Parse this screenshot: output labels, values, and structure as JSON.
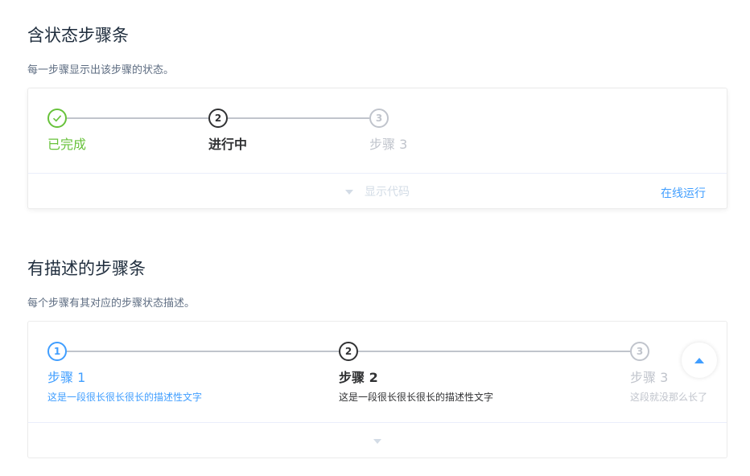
{
  "section1": {
    "title": "含状态步骤条",
    "description": "每一步骤显示出该步骤的状态。",
    "steps": [
      {
        "status": "success",
        "icon": "check-icon",
        "title": "已完成"
      },
      {
        "status": "process",
        "number": "2",
        "title": "进行中"
      },
      {
        "status": "wait",
        "number": "3",
        "title": "步骤 3"
      }
    ],
    "controls": {
      "toggle_label": "显示代码",
      "run_label": "在线运行"
    }
  },
  "section2": {
    "title": "有描述的步骤条",
    "description": "每个步骤有其对应的步骤状态描述。",
    "steps": [
      {
        "status": "finish",
        "number": "1",
        "title": "步骤 1",
        "description": "这是一段很长很长很长的描述性文字"
      },
      {
        "status": "process",
        "number": "2",
        "title": "步骤 2",
        "description": "这是一段很长很长很长的描述性文字"
      },
      {
        "status": "wait",
        "number": "3",
        "title": "步骤 3",
        "description": "这段就没那么长了"
      }
    ]
  },
  "colors": {
    "success": "#67c23a",
    "process": "#303133",
    "finish": "#409eff",
    "wait": "#c0c4cc"
  },
  "back_to_top_icon": "caret-up-icon"
}
